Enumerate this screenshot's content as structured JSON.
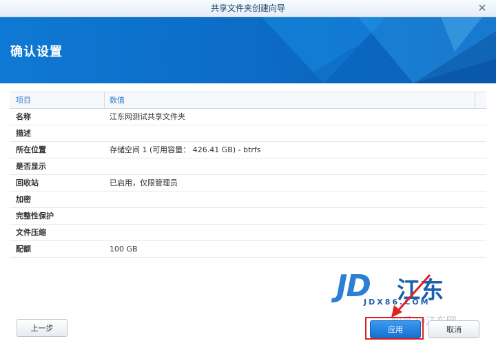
{
  "window": {
    "title": "共享文件夹创建向导",
    "close_glyph": "✕"
  },
  "banner": {
    "heading": "确认设置",
    "color": "#0f7bd6"
  },
  "table": {
    "headers": [
      "项目",
      "数值"
    ],
    "rows": [
      {
        "key": "名称",
        "value": "江东网测试共享文件夹"
      },
      {
        "key": "描述",
        "value": ""
      },
      {
        "key": "所在位置",
        "value": "存储空间 1 (可用容量： 426.41 GB) - btrfs"
      },
      {
        "key": "是否显示",
        "value": ""
      },
      {
        "key": "回收站",
        "value": "已启用，仅限管理员"
      },
      {
        "key": "加密",
        "value": ""
      },
      {
        "key": "完整性保护",
        "value": ""
      },
      {
        "key": "文件压缩",
        "value": ""
      },
      {
        "key": "配额",
        "value": "100 GB"
      }
    ]
  },
  "watermark": {
    "logo": "JD",
    "name": "江东",
    "url": "JDX86.COM",
    "zhihu": "知乎 @江东网"
  },
  "footer": {
    "prev_label": "上一步",
    "apply_label": "应用",
    "cancel_label": "取消"
  },
  "colors": {
    "accent": "#2f7bd2",
    "highlight": "#e02020"
  }
}
